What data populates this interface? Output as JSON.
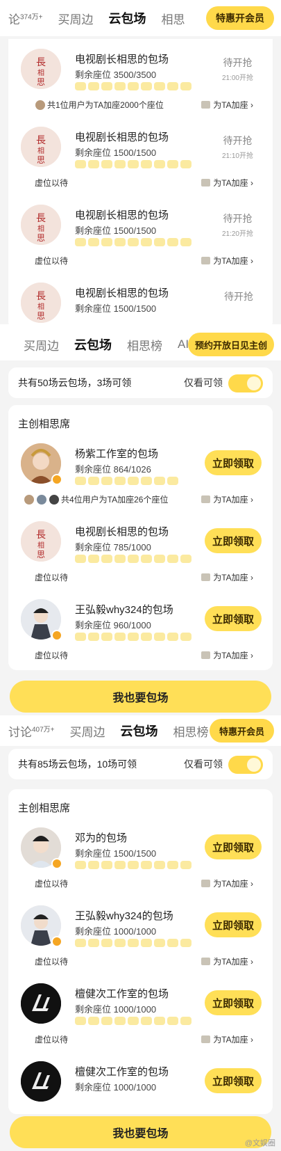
{
  "panel1": {
    "tabs": [
      {
        "label": "论",
        "sup": "374万+"
      },
      {
        "label": "买周边"
      },
      {
        "label": "云包场"
      },
      {
        "label": "相思"
      }
    ],
    "active_tab": 2,
    "vip_label": "特惠开会员",
    "rows": [
      {
        "title": "电视剧长相思的包场",
        "seats": "剩余座位 3500/3500",
        "status": "待开抢",
        "time": "21:00开抢",
        "foot_left": "共1位用户为TA加座2000个座位",
        "foot_right": "为TA加座 ›"
      },
      {
        "title": "电视剧长相思的包场",
        "seats": "剩余座位 1500/1500",
        "status": "待开抢",
        "time": "21:10开抢",
        "foot_left": "虚位以待",
        "foot_right": "为TA加座 ›"
      },
      {
        "title": "电视剧长相思的包场",
        "seats": "剩余座位 1500/1500",
        "status": "待开抢",
        "time": "21:20开抢",
        "foot_left": "虚位以待",
        "foot_right": "为TA加座 ›"
      },
      {
        "title": "电视剧长相思的包场",
        "seats": "剩余座位 1500/1500",
        "status": "待开抢",
        "time": "",
        "foot_left": "",
        "foot_right": ""
      }
    ]
  },
  "panel2": {
    "tabs": [
      {
        "label": "买周边"
      },
      {
        "label": "云包场"
      },
      {
        "label": "相思榜"
      },
      {
        "label": "AI"
      }
    ],
    "active_tab": 1,
    "vip_label": "预约开放日见主创",
    "filter_text": "共有50场云包场，3场可领",
    "only_label": "仅看可领",
    "section": "主创相思席",
    "rows": [
      {
        "title": "杨紫工作室的包场",
        "seats": "剩余座位 864/1026",
        "button": "立即领取",
        "foot_left": "共4位用户为TA加座26个座位",
        "foot_right": "为TA加座 ›"
      },
      {
        "title": "电视剧长相思的包场",
        "seats": "剩余座位 785/1000",
        "button": "立即领取",
        "foot_left": "虚位以待",
        "foot_right": "为TA加座 ›"
      },
      {
        "title": "王弘毅why324的包场",
        "seats": "剩余座位 960/1000",
        "button": "立即领取",
        "foot_left": "虚位以待",
        "foot_right": "为TA加座 ›"
      }
    ],
    "big_button": "我也要包场"
  },
  "panel3": {
    "tabs": [
      {
        "label": "讨论",
        "sup": "407万+"
      },
      {
        "label": "买周边"
      },
      {
        "label": "云包场"
      },
      {
        "label": "相思榜"
      }
    ],
    "active_tab": 2,
    "vip_label": "特惠开会员",
    "filter_text": "共有85场云包场，10场可领",
    "only_label": "仅看可领",
    "section": "主创相思席",
    "rows": [
      {
        "title": "邓为的包场",
        "seats": "剩余座位 1500/1500",
        "button": "立即领取",
        "foot_left": "虚位以待",
        "foot_right": "为TA加座 ›"
      },
      {
        "title": "王弘毅why324的包场",
        "seats": "剩余座位 1000/1000",
        "button": "立即领取",
        "foot_left": "虚位以待",
        "foot_right": "为TA加座 ›"
      },
      {
        "title": "檀健次工作室的包场",
        "seats": "剩余座位 1000/1000",
        "button": "立即领取",
        "foot_left": "虚位以待",
        "foot_right": "为TA加座 ›"
      },
      {
        "title": "檀健次工作室的包场",
        "seats": "剩余座位 1000/1000",
        "button": "立即领取",
        "foot_left": "",
        "foot_right": ""
      }
    ],
    "big_button": "我也要包场",
    "watermark": "@文娱圈"
  },
  "colors": {
    "accent": "#ffd94a",
    "button": "#ffdf57",
    "bg": "#f4f4f4"
  }
}
